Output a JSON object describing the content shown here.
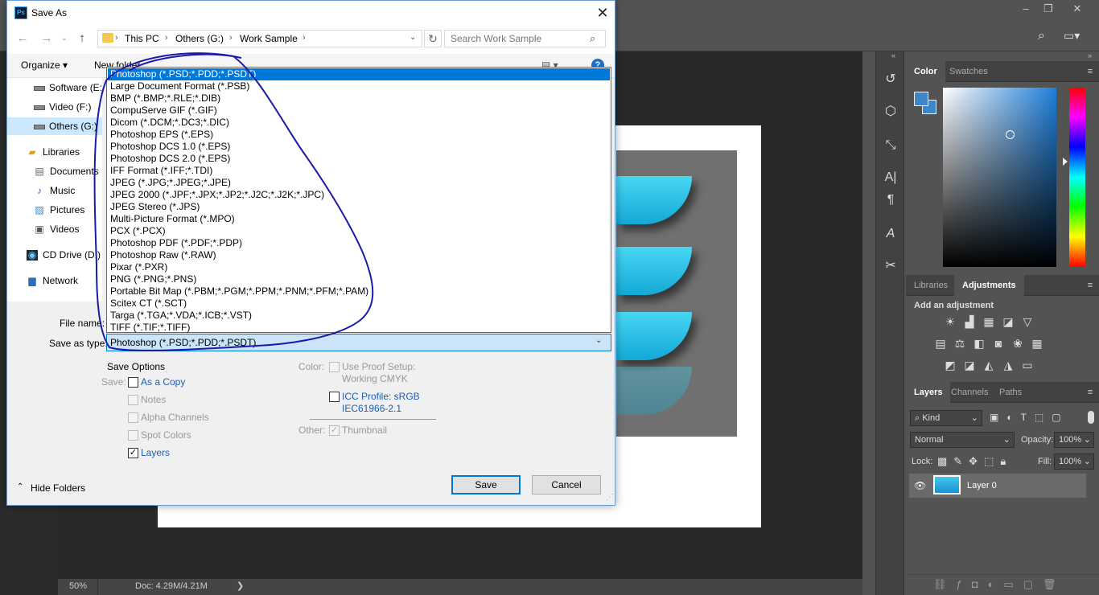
{
  "photoshop": {
    "zoom": "50%",
    "doc_info": "Doc: 4.29M/4.21M",
    "status_arrow": "❯",
    "panels": {
      "color_tabs": [
        "Color",
        "Swatches"
      ],
      "adjust_tabs": [
        "Libraries",
        "Adjustments"
      ],
      "add_adjustment": "Add an adjustment",
      "layers_tabs": [
        "Layers",
        "Channels",
        "Paths"
      ],
      "kind_filter": "Kind",
      "blend_mode": "Normal",
      "opacity_label": "Opacity:",
      "opacity_value": "100%",
      "lock_label": "Lock:",
      "fill_label": "Fill:",
      "fill_value": "100%",
      "layer_name": "Layer 0",
      "foreground_color": "#3f86c6"
    }
  },
  "dialog": {
    "title": "Save As",
    "icon_text": "Ps",
    "breadcrumbs": [
      "This PC",
      "Others (G:)",
      "Work Sample"
    ],
    "search_placeholder": "Search Work Sample",
    "toolbar": {
      "organize": "Organize ▾",
      "new_folder": "New folder"
    },
    "tree": [
      {
        "label": "Software (E:)",
        "icon": "drive"
      },
      {
        "label": "Video (F:)",
        "icon": "drive"
      },
      {
        "label": "Others (G:)",
        "icon": "drive",
        "selected": true
      },
      {
        "label": "Libraries",
        "icon": "libraries"
      },
      {
        "label": "Documents",
        "icon": "documents"
      },
      {
        "label": "Music",
        "icon": "music"
      },
      {
        "label": "Pictures",
        "icon": "pictures"
      },
      {
        "label": "Videos",
        "icon": "videos"
      },
      {
        "label": "CD Drive (D:) G",
        "icon": "cd"
      },
      {
        "label": "Network",
        "icon": "network"
      }
    ],
    "file_types": [
      "Photoshop (*.PSD;*.PDD;*.PSDT)",
      "Large Document Format (*.PSB)",
      "BMP (*.BMP;*.RLE;*.DIB)",
      "CompuServe GIF (*.GIF)",
      "Dicom (*.DCM;*.DC3;*.DIC)",
      "Photoshop EPS (*.EPS)",
      "Photoshop DCS 1.0 (*.EPS)",
      "Photoshop DCS 2.0 (*.EPS)",
      "IFF Format (*.IFF;*.TDI)",
      "JPEG (*.JPG;*.JPEG;*.JPE)",
      "JPEG 2000 (*.JPF;*.JPX;*.JP2;*.J2C;*.J2K;*.JPC)",
      "JPEG Stereo (*.JPS)",
      "Multi-Picture Format (*.MPO)",
      "PCX (*.PCX)",
      "Photoshop PDF (*.PDF;*.PDP)",
      "Photoshop Raw (*.RAW)",
      "Pixar (*.PXR)",
      "PNG (*.PNG;*.PNS)",
      "Portable Bit Map (*.PBM;*.PGM;*.PPM;*.PNM;*.PFM;*.PAM)",
      "Scitex CT (*.SCT)",
      "Targa (*.TGA;*.VDA;*.ICB;*.VST)",
      "TIFF (*.TIF;*.TIFF)"
    ],
    "file_name_label": "File name:",
    "save_as_type_label": "Save as type:",
    "save_as_type_value": "Photoshop (*.PSD;*.PDD;*.PSDT)",
    "save_options": {
      "heading": "Save Options",
      "save_label": "Save:",
      "as_a_copy": "As a Copy",
      "notes": "Notes",
      "alpha_channels": "Alpha Channels",
      "spot_colors": "Spot Colors",
      "layers": "Layers",
      "color_label": "Color:",
      "use_proof_setup": "Use Proof Setup:",
      "working_cmyk": "Working CMYK",
      "icc_profile": "ICC Profile:  sRGB",
      "icc_profile_2": "IEC61966-2.1",
      "other_label": "Other:",
      "thumbnail": "Thumbnail"
    },
    "hide_folders": "Hide Folders",
    "save_button": "Save",
    "cancel_button": "Cancel"
  }
}
